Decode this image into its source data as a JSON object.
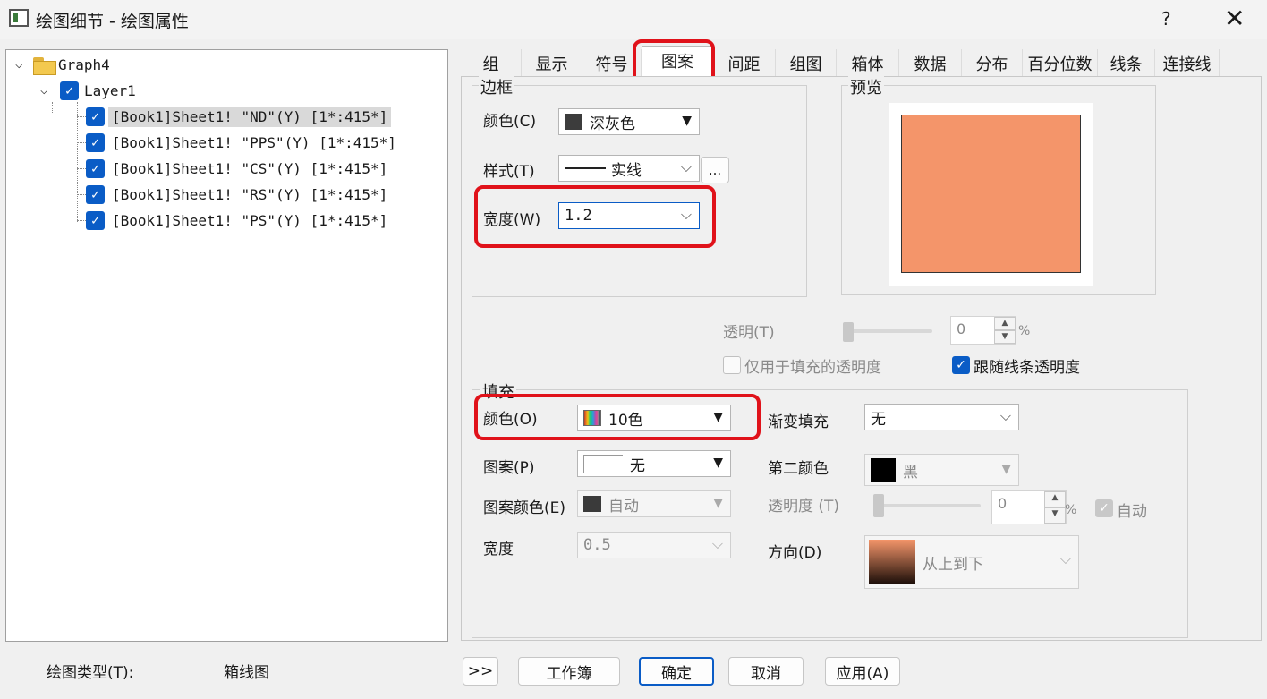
{
  "window": {
    "title": "绘图细节 - 绘图属性",
    "help": "?",
    "close": "✕"
  },
  "tree": {
    "root": "Graph4",
    "layer": "Layer1",
    "items": [
      "[Book1]Sheet1! \"ND\"(Y) [1*:415*]",
      "[Book1]Sheet1! \"PPS\"(Y) [1*:415*]",
      "[Book1]Sheet1! \"CS\"(Y) [1*:415*]",
      "[Book1]Sheet1! \"RS\"(Y) [1*:415*]",
      "[Book1]Sheet1! \"PS\"(Y) [1*:415*]"
    ]
  },
  "tabs": [
    "组",
    "显示",
    "符号",
    "图案",
    "间距",
    "组图",
    "箱体",
    "数据",
    "分布",
    "百分位数",
    "线条",
    "连接线"
  ],
  "active_tab": "图案",
  "border": {
    "group_label": "边框",
    "color_label": "颜色(C)",
    "color_value": "深灰色",
    "color_hex": "#3c3c3c",
    "style_label": "样式(T)",
    "style_value": "实线",
    "style_more": "...",
    "width_label": "宽度(W)",
    "width_value": "1.2"
  },
  "preview": {
    "group_label": "预览",
    "fill_hex": "#f4956a"
  },
  "transparency": {
    "label": "透明(T)",
    "value": "0",
    "unit": "%",
    "fill_only_label": "仅用于填充的透明度",
    "follow_line_label": "跟随线条透明度"
  },
  "fill": {
    "group_label": "填充",
    "color_label": "颜色(O)",
    "color_value": "10色",
    "pattern_label": "图案(P)",
    "pattern_value": "无",
    "pattern_color_label": "图案颜色(E)",
    "pattern_color_value": "自动",
    "width_label": "宽度",
    "width_value": "0.5",
    "gradient_label": "渐变填充",
    "gradient_value": "无",
    "second_color_label": "第二颜色",
    "second_color_value": "黑",
    "opacity_label": "透明度 (T)",
    "opacity_value": "0",
    "opacity_unit": "%",
    "auto_label": "自动",
    "direction_label": "方向(D)",
    "direction_value": "从上到下"
  },
  "footer": {
    "plot_type_label": "绘图类型(T):",
    "plot_type_value": "箱线图",
    "expand": ">>",
    "workbook": "工作簿",
    "ok": "确定",
    "cancel": "取消",
    "apply": "应用(A)"
  }
}
